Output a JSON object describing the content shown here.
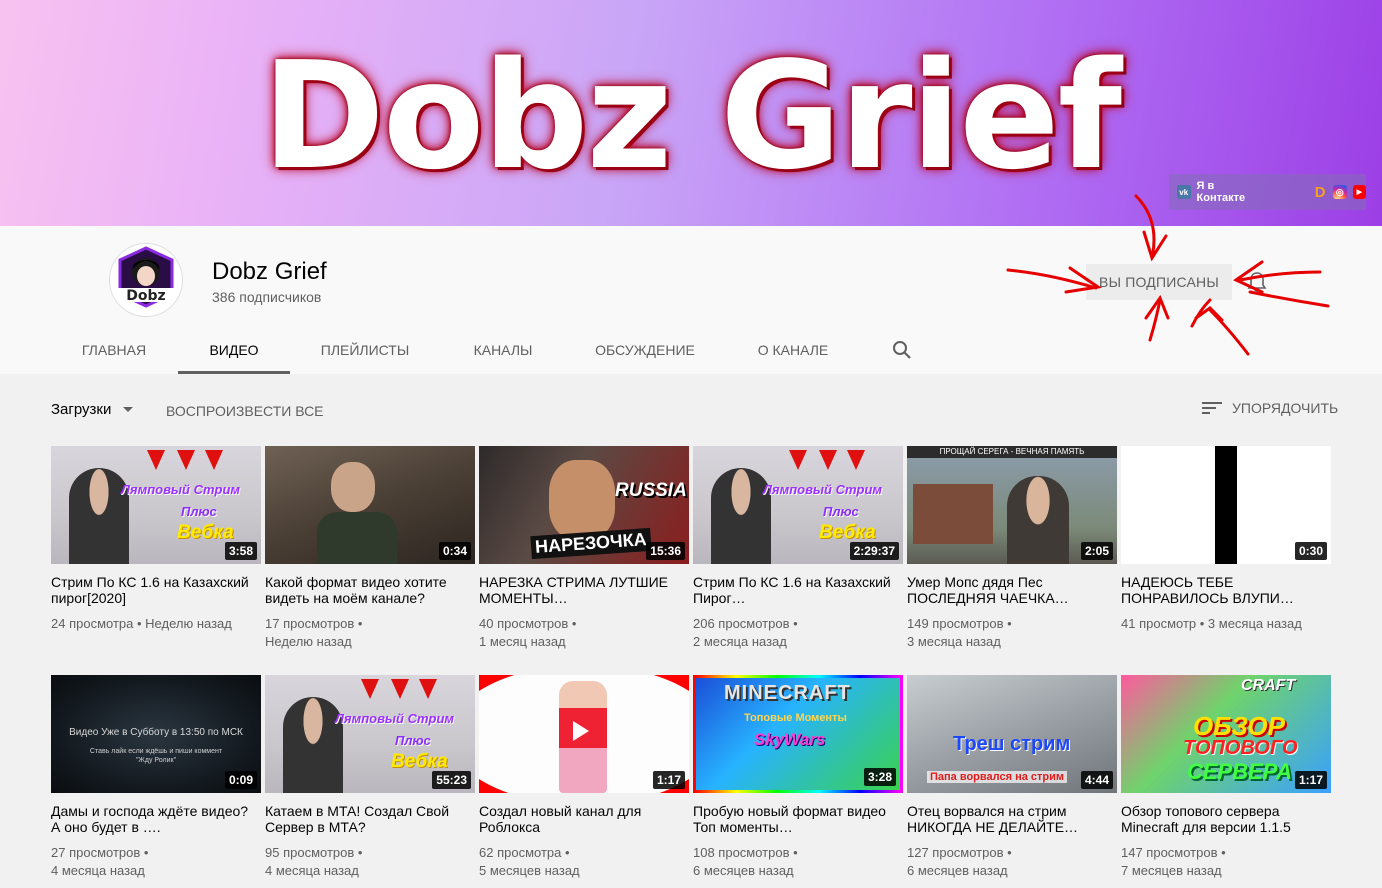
{
  "banner": {
    "title": "Dobz Grief",
    "vk_label": "Я в Контакте",
    "vk_badge": "vk",
    "social_icons": [
      "vk-icon",
      "donationalerts-icon",
      "instagram-icon",
      "youtube-icon"
    ],
    "gradient": [
      "#f8c2f0",
      "#c9a6f7",
      "#9c3fe6"
    ]
  },
  "channel": {
    "name": "Dobz Grief",
    "subscribers": "386 подписчиков",
    "avatar_text": "Dobz",
    "subscribed_label": "ВЫ ПОДПИСАНЫ"
  },
  "tabs": [
    {
      "label": "ГЛАВНАЯ",
      "active": false
    },
    {
      "label": "ВИДЕО",
      "active": true
    },
    {
      "label": "ПЛЕЙЛИСТЫ",
      "active": false
    },
    {
      "label": "КАНАЛЫ",
      "active": false
    },
    {
      "label": "ОБСУЖДЕНИЕ",
      "active": false
    },
    {
      "label": "О КАНАЛЕ",
      "active": false
    }
  ],
  "toolbar": {
    "uploads_label": "Загрузки",
    "play_all_label": "ВОСПРОИЗВЕСТИ ВСЕ",
    "sort_label": "УПОРЯДОЧИТЬ"
  },
  "videos": [
    {
      "title": "Стрим По КС 1.6 на Казахский пирог[2020]",
      "views": "24 просмотра",
      "age": "Неделю назад",
      "duration": "3:58",
      "thumb_text": [
        "Лямповый Стрим",
        "Плюс",
        "Вебка"
      ]
    },
    {
      "title": "Какой формат видео хотите видеть на моём канале?",
      "views": "17 просмотров",
      "age": "Неделю назад",
      "duration": "0:34"
    },
    {
      "title": "НАРЕЗКА СТРИМА ЛУТШИЕ МОМЕНТЫ…",
      "views": "40 просмотров",
      "age": "1 месяц назад",
      "duration": "15:36",
      "thumb_text": [
        "RUSSIA",
        "НАРЕЗОЧКА"
      ]
    },
    {
      "title": "Стрим По КС 1.6 на Казахский Пирог…",
      "views": "206 просмотров",
      "age": "2 месяца назад",
      "duration": "2:29:37",
      "thumb_text": [
        "Лямповый Стрим",
        "Плюс",
        "Вебка"
      ]
    },
    {
      "title": "Умер Мопс дядя Пес ПОСЛЕДНЯЯ ЧАЕЧКА…",
      "views": "149 просмотров",
      "age": "3 месяца назад",
      "duration": "2:05",
      "thumb_text": [
        "ПРОЩАЙ СЕРЕГА - ВЕЧНАЯ ПАМЯТЬ"
      ]
    },
    {
      "title": "НАДЕЮСЬ ТЕБЕ ПОНРАВИЛОСЬ ВЛУПИ…",
      "views": "41 просмотр",
      "age": "3 месяца назад",
      "duration": "0:30"
    },
    {
      "title": "Дамы и господа ждёте видео? А оно будет в ….",
      "views": "27 просмотров",
      "age": "4 месяца назад",
      "duration": "0:09",
      "thumb_text": [
        "Видео Уже в Субботу в 13:50 по МСК",
        "Ставь лайк если ждёшь и пиши коммент",
        "\"Жду Ролик\""
      ]
    },
    {
      "title": "Катаем в МТА! Создал Свой Сервер в МТА?",
      "views": "95 просмотров",
      "age": "4 месяца назад",
      "duration": "55:23",
      "thumb_text": [
        "Лямповый Стрим",
        "Плюс",
        "Вебка"
      ]
    },
    {
      "title": "Создал новый канал для Роблокса",
      "views": "62 просмотра",
      "age": "5 месяцев назад",
      "duration": "1:17"
    },
    {
      "title": "Пробую новый формат видео Топ моменты…",
      "views": "108 просмотров",
      "age": "6 месяцев назад",
      "duration": "3:28",
      "thumb_text": [
        "MINECRAFT",
        "Топовые Моменты",
        "SkyWars"
      ]
    },
    {
      "title": "Отец ворвался на стрим НИКОГДА НЕ ДЕЛАЙТЕ…",
      "views": "127 просмотров",
      "age": "6 месяцев назад",
      "duration": "4:44",
      "thumb_text": [
        "Треш стрим",
        "Папа ворвался на стрим"
      ]
    },
    {
      "title": "Обзор топового сервера Minecraft для версии 1.1.5",
      "views": "147 просмотров",
      "age": "7 месяцев назад",
      "duration": "1:17",
      "thumb_text": [
        "CRAFT",
        "ОБЗОР",
        "ТОПОВОГО",
        "СЕРВЕРА"
      ]
    }
  ],
  "colors": {
    "accent_red": "#e60000",
    "text_primary": "#030303",
    "text_secondary": "#606060",
    "header_bg": "#f9f9f9",
    "page_bg": "#f1f1f1"
  }
}
